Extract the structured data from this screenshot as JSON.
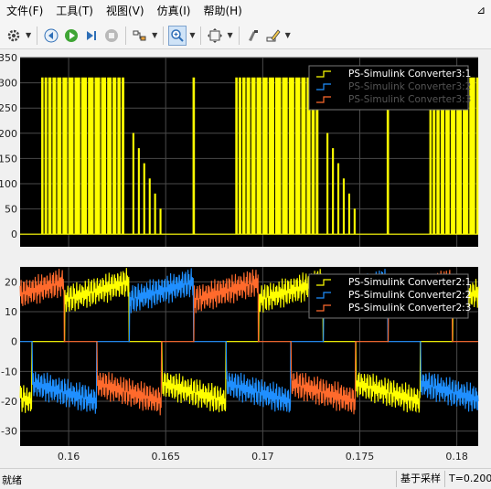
{
  "menu": {
    "items": [
      "文件(F)",
      "工具(T)",
      "视图(V)",
      "仿真(I)",
      "帮助(H)"
    ]
  },
  "toolbar": {
    "buttons": [
      "settings-icon",
      "step-back-icon",
      "run-icon",
      "step-forward-icon",
      "stop-icon",
      "highlight-signal-icon",
      "zoom-icon",
      "fit-to-view-icon",
      "style-icon",
      "edit-icon"
    ]
  },
  "plot_top": {
    "ylim": [
      -25,
      350
    ],
    "yticks": [
      "0",
      "50",
      "100",
      "150",
      "200",
      "250",
      "300",
      "350"
    ],
    "legend": [
      "PS-Simulink Converter3:1",
      "PS-Simulink Converter3:2",
      "PS-Simulink Converter3:3"
    ]
  },
  "plot_bottom": {
    "ylim": [
      -35,
      25
    ],
    "yticks": [
      "-30",
      "-20",
      "-10",
      "0",
      "10",
      "20"
    ],
    "legend": [
      "PS-Simulink Converter2:1",
      "PS-Simulink Converter2:2",
      "PS-Simulink Converter2:3"
    ]
  },
  "xaxis": {
    "xlim": [
      0.1575,
      0.1811
    ],
    "ticks": [
      "0.16",
      "0.165",
      "0.17",
      "0.175",
      "0.18"
    ]
  },
  "colors": {
    "series1": "#ffff00",
    "series2": "#1f8fff",
    "series3": "#ff6a2c",
    "plot_bg": "#000000",
    "grid": "#4a4a4a"
  },
  "chart_data": [
    {
      "type": "line",
      "title": "",
      "x_range": [
        0.1575,
        0.1811
      ],
      "ylim": [
        -25,
        350
      ],
      "series": [
        {
          "name": "PS-Simulink Converter3:1",
          "description_values": [
            0,
            310
          ]
        },
        {
          "name": "PS-Simulink Converter3:2",
          "description_values": []
        },
        {
          "name": "PS-Simulink Converter3:3",
          "description_values": []
        }
      ]
    },
    {
      "type": "line",
      "title": "",
      "x_range": [
        0.1575,
        0.1811
      ],
      "ylim": [
        -35,
        25
      ],
      "series": [
        {
          "name": "PS-Simulink Converter2:1",
          "amplitude": 20
        },
        {
          "name": "PS-Simulink Converter2:2",
          "amplitude": 20
        },
        {
          "name": "PS-Simulink Converter2:3",
          "amplitude": 20
        }
      ]
    }
  ],
  "status": {
    "left": "就绪",
    "mode": "基于采样",
    "time": "T=0.200"
  }
}
